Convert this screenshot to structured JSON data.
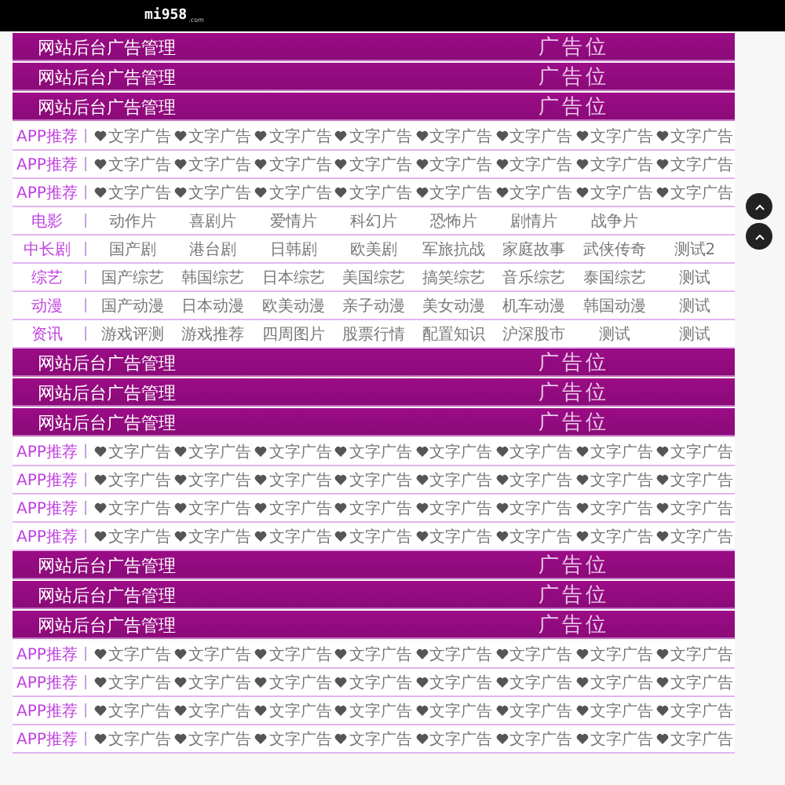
{
  "header": {
    "logo": "mi958",
    "logo_suffix": ".com"
  },
  "sections": [
    {
      "kind": "banner",
      "title": "网站后台广告管理",
      "slot": "广告位"
    },
    {
      "kind": "banner",
      "title": "网站后台广告管理",
      "slot": "广告位"
    },
    {
      "kind": "banner",
      "title": "网站后台广告管理",
      "slot": "广告位"
    },
    {
      "kind": "ads",
      "label": "APP推荐",
      "items": [
        "文字广告",
        "文字广告",
        "文字广告",
        "文字广告",
        "文字广告",
        "文字广告",
        "文字广告",
        "文字广告"
      ]
    },
    {
      "kind": "ads",
      "label": "APP推荐",
      "items": [
        "文字广告",
        "文字广告",
        "文字广告",
        "文字广告",
        "文字广告",
        "文字广告",
        "文字广告",
        "文字广告"
      ]
    },
    {
      "kind": "ads",
      "label": "APP推荐",
      "items": [
        "文字广告",
        "文字广告",
        "文字广告",
        "文字广告",
        "文字广告",
        "文字广告",
        "文字广告",
        "文字广告"
      ]
    },
    {
      "kind": "category",
      "label": "电影",
      "items": [
        "动作片",
        "喜剧片",
        "爱情片",
        "科幻片",
        "恐怖片",
        "剧情片",
        "战争片"
      ]
    },
    {
      "kind": "category",
      "label": "中长剧",
      "items": [
        "国产剧",
        "港台剧",
        "日韩剧",
        "欧美剧",
        "军旅抗战",
        "家庭故事",
        "武侠传奇",
        "测试2"
      ]
    },
    {
      "kind": "category",
      "label": "综艺",
      "items": [
        "国产综艺",
        "韩国综艺",
        "日本综艺",
        "美国综艺",
        "搞笑综艺",
        "音乐综艺",
        "泰国综艺",
        "测试"
      ]
    },
    {
      "kind": "category",
      "label": "动漫",
      "items": [
        "国产动漫",
        "日本动漫",
        "欧美动漫",
        "亲子动漫",
        "美女动漫",
        "机车动漫",
        "韩国动漫",
        "测试"
      ]
    },
    {
      "kind": "category",
      "label": "资讯",
      "items": [
        "游戏评测",
        "游戏推荐",
        "四周图片",
        "股票行情",
        "配置知识",
        "沪深股市",
        "测试",
        "测试"
      ]
    },
    {
      "kind": "banner",
      "title": "网站后台广告管理",
      "slot": "广告位"
    },
    {
      "kind": "banner",
      "title": "网站后台广告管理",
      "slot": "广告位"
    },
    {
      "kind": "banner",
      "title": "网站后台广告管理",
      "slot": "广告位"
    },
    {
      "kind": "ads",
      "label": "APP推荐",
      "items": [
        "文字广告",
        "文字广告",
        "文字广告",
        "文字广告",
        "文字广告",
        "文字广告",
        "文字广告",
        "文字广告"
      ]
    },
    {
      "kind": "ads",
      "label": "APP推荐",
      "items": [
        "文字广告",
        "文字广告",
        "文字广告",
        "文字广告",
        "文字广告",
        "文字广告",
        "文字广告",
        "文字广告"
      ]
    },
    {
      "kind": "ads",
      "label": "APP推荐",
      "items": [
        "文字广告",
        "文字广告",
        "文字广告",
        "文字广告",
        "文字广告",
        "文字广告",
        "文字广告",
        "文字广告"
      ]
    },
    {
      "kind": "ads",
      "label": "APP推荐",
      "items": [
        "文字广告",
        "文字广告",
        "文字广告",
        "文字广告",
        "文字广告",
        "文字广告",
        "文字广告",
        "文字广告"
      ]
    },
    {
      "kind": "banner",
      "title": "网站后台广告管理",
      "slot": "广告位"
    },
    {
      "kind": "banner",
      "title": "网站后台广告管理",
      "slot": "广告位"
    },
    {
      "kind": "banner",
      "title": "网站后台广告管理",
      "slot": "广告位"
    },
    {
      "kind": "ads",
      "label": "APP推荐",
      "items": [
        "文字广告",
        "文字广告",
        "文字广告",
        "文字广告",
        "文字广告",
        "文字广告",
        "文字广告",
        "文字广告"
      ]
    },
    {
      "kind": "ads",
      "label": "APP推荐",
      "items": [
        "文字广告",
        "文字广告",
        "文字广告",
        "文字广告",
        "文字广告",
        "文字广告",
        "文字广告",
        "文字广告"
      ]
    },
    {
      "kind": "ads",
      "label": "APP推荐",
      "items": [
        "文字广告",
        "文字广告",
        "文字广告",
        "文字广告",
        "文字广告",
        "文字广告",
        "文字广告",
        "文字广告"
      ]
    },
    {
      "kind": "ads",
      "label": "APP推荐",
      "items": [
        "文字广告",
        "文字广告",
        "文字广告",
        "文字广告",
        "文字广告",
        "文字广告",
        "文字广告",
        "文字广告"
      ]
    }
  ]
}
